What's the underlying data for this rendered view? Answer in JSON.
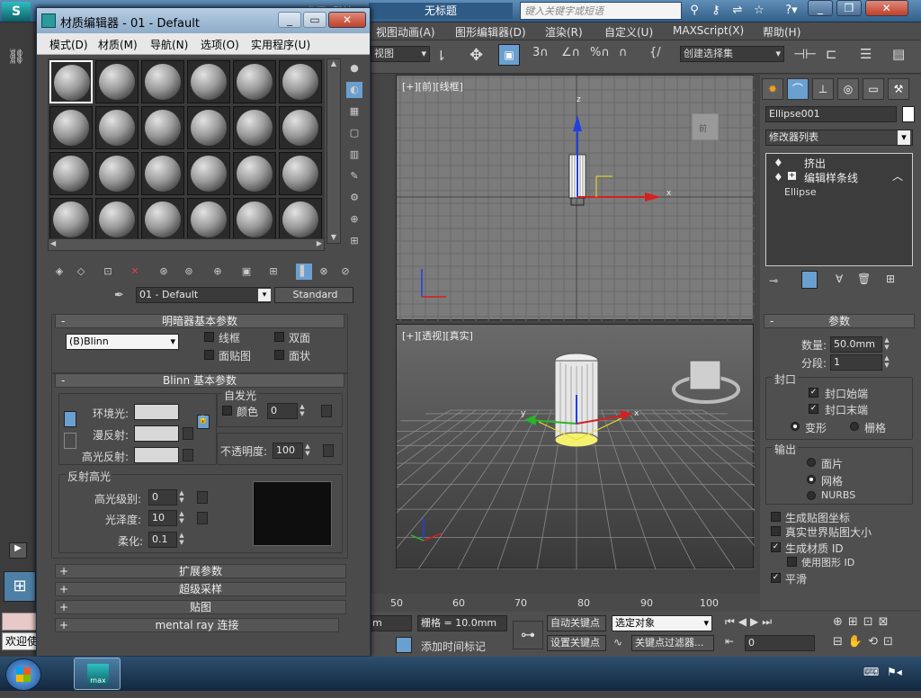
{
  "max_titlebar": {
    "doc_title": "无标题",
    "partial_tab": "工作区: 默认",
    "search_placeholder": "键入关键字或短语"
  },
  "menubar": [
    "视图",
    "动画(A)",
    "图形编辑器(D)",
    "渲染(R)",
    "自定义(U)",
    "MAXScript(X)",
    "帮助(H)"
  ],
  "toolbar": {
    "view_dropdown": "视图",
    "selection_set": "创建选择集"
  },
  "viewports": {
    "top_label": "[+][前][线框]",
    "persp_label": "[+][透视][真实]",
    "viewcube_top": "前"
  },
  "command_panel": {
    "object_name": "Ellipse001",
    "modifier_list": "修改器列表",
    "stack": [
      "挤出",
      "编辑样条线",
      "Ellipse"
    ],
    "params_title": "参数",
    "amount_label": "数量:",
    "amount_value": "50.0mm",
    "segments_label": "分段:",
    "segments_value": "1",
    "capping_title": "封口",
    "cap_start": "封口始端",
    "cap_end": "封口末端",
    "morph": "变形",
    "grid": "栅格",
    "output_title": "输出",
    "out_patch": "面片",
    "out_mesh": "网格",
    "out_nurbs": "NURBS",
    "gen_map_coords": "生成贴图坐标",
    "real_world": "真实世界贴图大小",
    "gen_mat_ids": "生成材质 ID",
    "use_shape_ids": "使用图形 ID",
    "smooth": "平滑"
  },
  "timeline": {
    "ticks": [
      "50",
      "60",
      "70",
      "80",
      "90",
      "100"
    ]
  },
  "status": {
    "grid": "栅格 = 10.0mm",
    "add_time_tag": "添加时间标记",
    "auto_key": "自动关键点",
    "set_key": "设置关键点",
    "selected": "选定对象",
    "key_filters": "关键点过滤器...",
    "frame": "0",
    "partial_unit": "m",
    "welcome": "欢迎使"
  },
  "mat_editor": {
    "title": "材质编辑器 - 01 - Default",
    "menu": [
      "模式(D)",
      "材质(M)",
      "导航(N)",
      "选项(O)",
      "实用程序(U)"
    ],
    "material_name": "01 - Default",
    "material_type": "Standard",
    "shader_basic": "明暗器基本参数",
    "shader_type": "(B)Blinn",
    "wire": "线框",
    "two_sided": "双面",
    "face_map": "面贴图",
    "faceted": "面状",
    "blinn_basic": "Blinn 基本参数",
    "self_illum": "自发光",
    "color": "颜色",
    "color_value": "0",
    "ambient": "环境光:",
    "diffuse": "漫反射:",
    "specular": "高光反射:",
    "opacity": "不透明度:",
    "opacity_value": "100",
    "spec_highlights": "反射高光",
    "spec_level": "高光级别:",
    "spec_level_value": "0",
    "gloss": "光泽度:",
    "gloss_value": "10",
    "soften": "柔化:",
    "soften_value": "0.1",
    "rollouts": [
      "扩展参数",
      "超级采样",
      "贴图",
      "mental ray 连接"
    ]
  },
  "colors": {
    "viewport_bg": "#7b7b7b",
    "axis_x": "#d42020",
    "axis_y": "#28b428",
    "axis_z": "#2040e0",
    "selection": "#f0e020"
  }
}
